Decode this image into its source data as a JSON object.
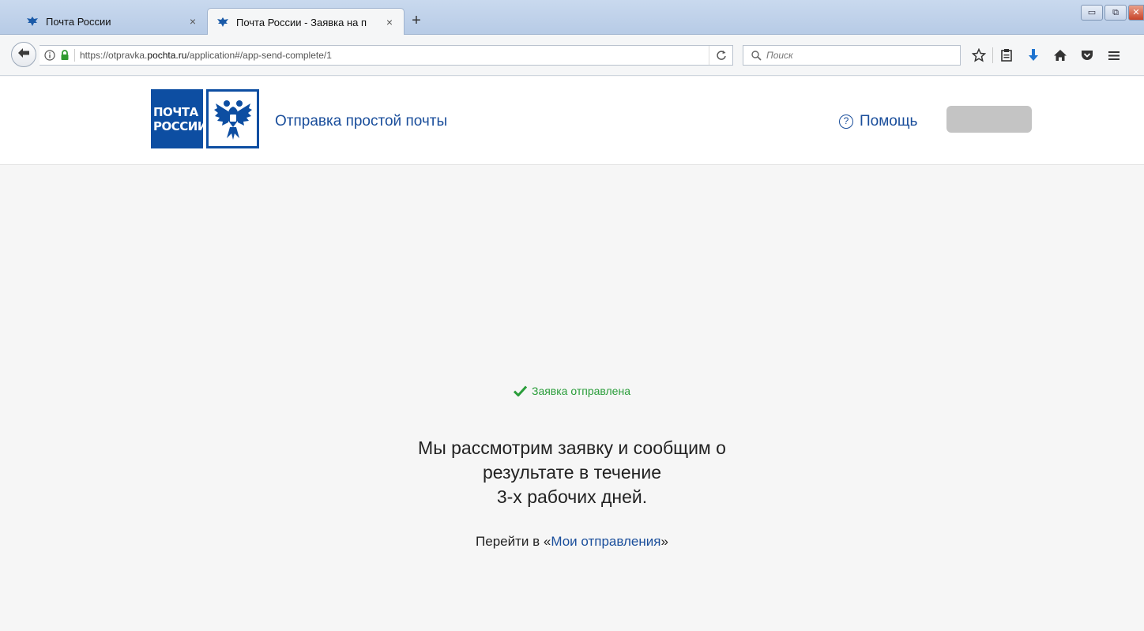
{
  "browser": {
    "tabs": [
      {
        "title": "Почта России",
        "close": "×"
      },
      {
        "title": "Почта России - Заявка на п",
        "close": "×"
      }
    ],
    "new_tab": "+",
    "window_buttons": {
      "minimize": "▭",
      "restore": "⧉",
      "close": "✕"
    },
    "url_prefix": "https://otpravka.",
    "url_domain": "pochta.ru",
    "url_suffix": "/application#/app-send-complete/1",
    "reload": "C",
    "search_placeholder": "Поиск",
    "icons": [
      "back-arrow-icon",
      "info-icon",
      "lock-icon",
      "reload-icon",
      "search-icon",
      "bookmark-star-icon",
      "reading-list-icon",
      "download-icon",
      "home-icon",
      "pocket-icon",
      "menu-icon"
    ]
  },
  "site": {
    "logo_text_line1": "ПОЧТА",
    "logo_text_line2": "РОССИИ",
    "title": "Отправка простой почты",
    "help_icon": "?",
    "help_label": "Помощь"
  },
  "content": {
    "status_text": "Заявка отправлена",
    "message_line1": "Мы рассмотрим заявку и сообщим о",
    "message_line2": "результате в течение",
    "message_line3": "3-х рабочих дней.",
    "goto_prefix": "Перейти в «",
    "goto_link": "Мои отправления",
    "goto_suffix": "»"
  },
  "colors": {
    "brand_blue": "#0d4ea2",
    "link_blue": "#1a4e9b",
    "success_green": "#2a9d3a"
  }
}
